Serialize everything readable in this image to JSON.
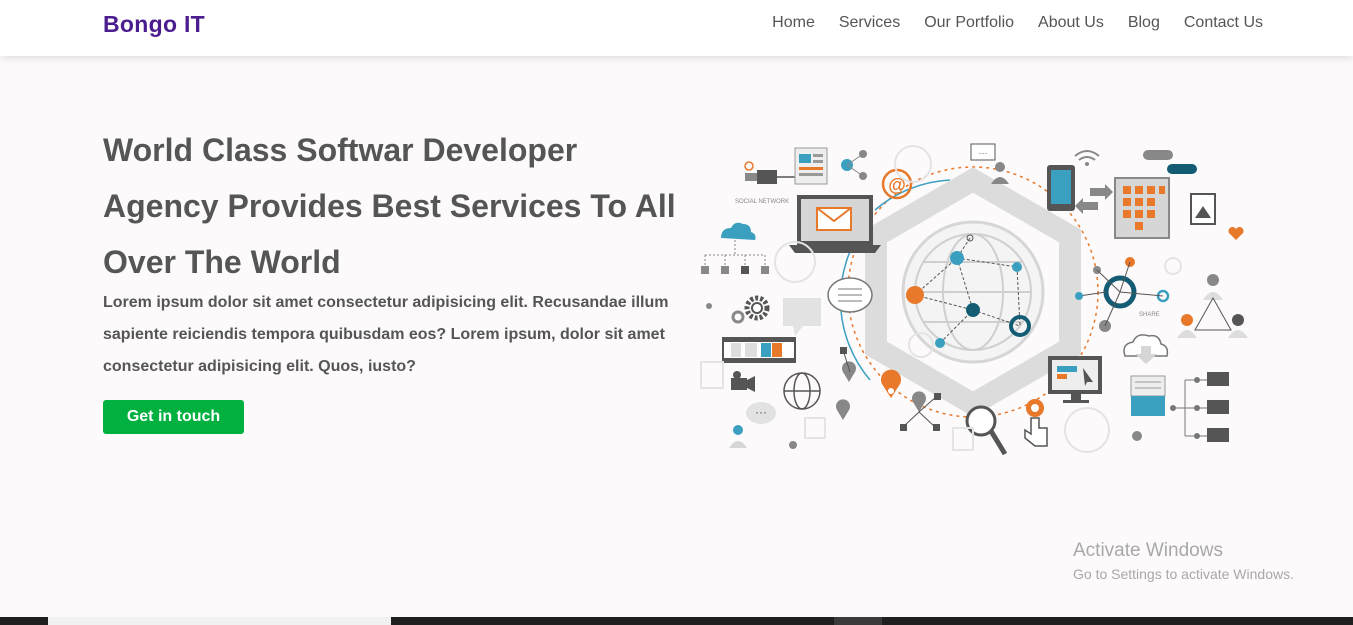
{
  "brand": "Bongo IT",
  "nav": [
    "Home",
    "Services",
    "Our Portfolio",
    "About Us",
    "Blog",
    "Contact Us"
  ],
  "hero": {
    "title_lines": [
      "World Class Softwar Developer",
      "Agency Provides Best Services To All",
      "Over The World"
    ],
    "text_lines": [
      "Lorem ipsum dolor sit amet consectetur adipisicing elit. Recusandae illum",
      "sapiente reiciendis tempora quibusdam eos? Lorem ipsum, dolor sit amet",
      "consectetur adipisicing elit. Quos, iusto?"
    ],
    "cta_label": "Get in touch"
  },
  "illustration": {
    "labels": [
      "SOCIAL NETWORK",
      "SHARE"
    ],
    "colors": {
      "blue": "#3b9fc0",
      "orange": "#e8782a",
      "gray": "#d6d6d6",
      "dark": "#555555",
      "teal": "#135c74"
    }
  },
  "watermark": {
    "line1": "Activate Windows",
    "line2": "Go to Settings to activate Windows."
  },
  "colors": {
    "brand": "#4b1d8e",
    "cta": "#00b140",
    "text": "#555555",
    "background": "#fdfafb"
  }
}
